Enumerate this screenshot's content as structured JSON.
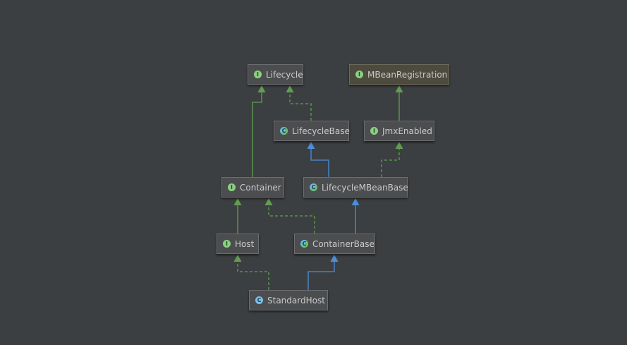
{
  "colors": {
    "background": "#3c3f41",
    "implements_edge": "#5f9f4f",
    "extends_edge": "#4c8ed9",
    "interface_badge": "#8ad182",
    "class_badge": "#7dbfe7"
  },
  "nodes": [
    {
      "id": "lifecycle",
      "label": "Lifecycle",
      "kind": "interface",
      "badge": "I",
      "icon": "interface-icon"
    },
    {
      "id": "mbeanregistration",
      "label": "MBeanRegistration",
      "kind": "interface",
      "badge": "I",
      "icon": "interface-icon"
    },
    {
      "id": "lifecyclebase",
      "label": "LifecycleBase",
      "kind": "abstract",
      "badge": "C",
      "icon": "abstract-class-icon"
    },
    {
      "id": "jmxenabled",
      "label": "JmxEnabled",
      "kind": "interface",
      "badge": "I",
      "icon": "interface-icon"
    },
    {
      "id": "container",
      "label": "Container",
      "kind": "interface",
      "badge": "I",
      "icon": "interface-icon"
    },
    {
      "id": "lifecyclembeanbase",
      "label": "LifecycleMBeanBase",
      "kind": "abstract",
      "badge": "C",
      "icon": "abstract-class-icon"
    },
    {
      "id": "host",
      "label": "Host",
      "kind": "interface",
      "badge": "I",
      "icon": "interface-icon"
    },
    {
      "id": "containerbase",
      "label": "ContainerBase",
      "kind": "abstract",
      "badge": "C",
      "icon": "abstract-class-icon"
    },
    {
      "id": "standardhost",
      "label": "StandardHost",
      "kind": "class",
      "badge": "C",
      "icon": "class-icon"
    }
  ],
  "edges": [
    {
      "from": "container",
      "to": "lifecycle",
      "type": "extends-interface"
    },
    {
      "from": "lifecyclebase",
      "to": "lifecycle",
      "type": "implements"
    },
    {
      "from": "jmxenabled",
      "to": "mbeanregistration",
      "type": "extends-interface"
    },
    {
      "from": "lifecyclembeanbase",
      "to": "lifecyclebase",
      "type": "extends"
    },
    {
      "from": "lifecyclembeanbase",
      "to": "jmxenabled",
      "type": "implements"
    },
    {
      "from": "host",
      "to": "container",
      "type": "extends-interface"
    },
    {
      "from": "containerbase",
      "to": "container",
      "type": "implements"
    },
    {
      "from": "containerbase",
      "to": "lifecyclembeanbase",
      "type": "extends"
    },
    {
      "from": "standardhost",
      "to": "host",
      "type": "implements"
    },
    {
      "from": "standardhost",
      "to": "containerbase",
      "type": "extends"
    }
  ]
}
